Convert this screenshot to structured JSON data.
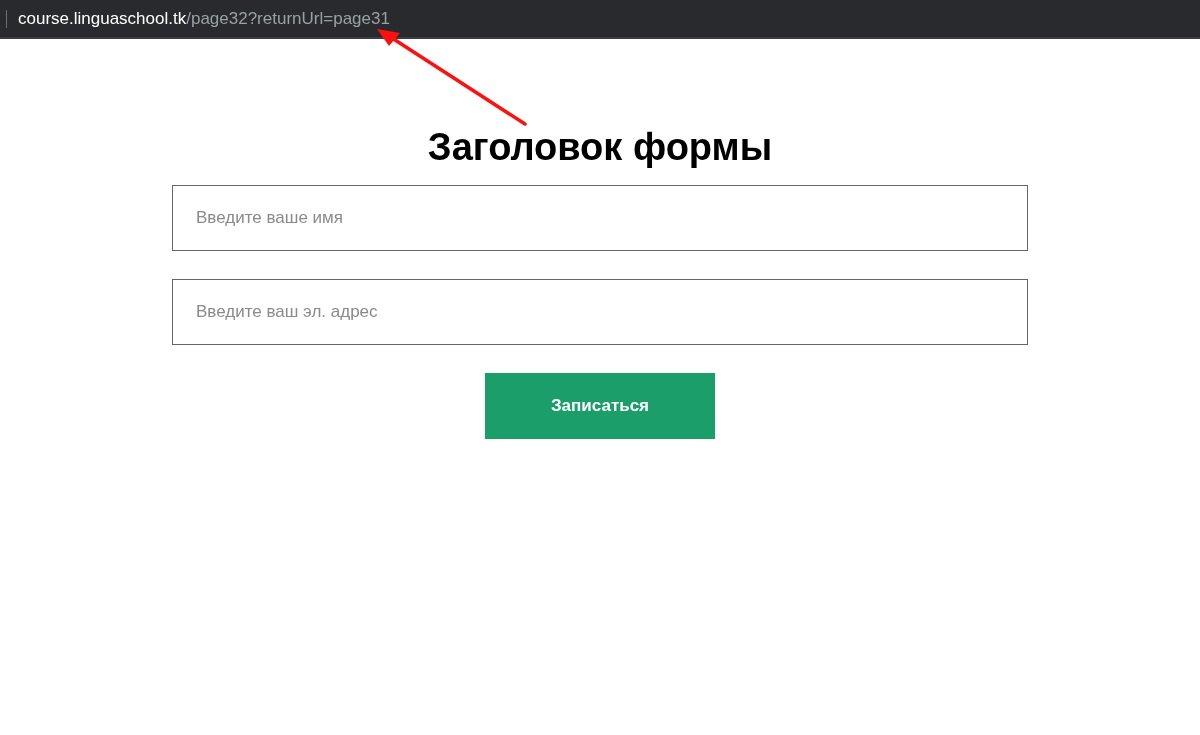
{
  "address_bar": {
    "host": "course.linguaschool.tk",
    "path": "/page32?returnUrl=page31"
  },
  "form": {
    "title": "Заголовок формы",
    "fields": [
      {
        "placeholder": "Введите ваше имя"
      },
      {
        "placeholder": "Введите ваш эл. адрес"
      }
    ],
    "submit": "Записаться"
  }
}
